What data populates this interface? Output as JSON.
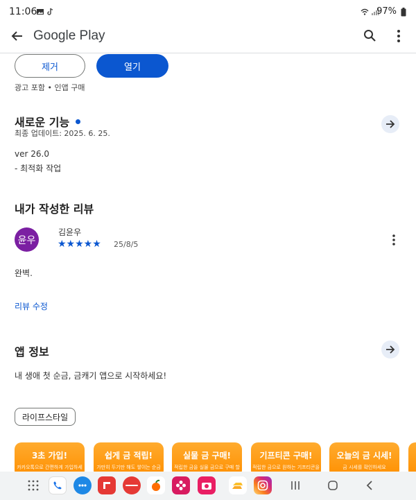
{
  "status_bar": {
    "time": "11:06",
    "battery": "97%"
  },
  "app_bar": {
    "title": "Google Play"
  },
  "actions": {
    "remove_label": "제거",
    "open_label": "열기",
    "notice": "광고 포함 • 인앱 구매"
  },
  "whats_new": {
    "title": "새로운 기능",
    "updated": "최종 업데이트: 2025. 6. 25.",
    "version": "ver 26.0",
    "note": "- 최적화 작업"
  },
  "my_review": {
    "title": "내가 작성한 리뷰",
    "avatar_text": "윤우",
    "reviewer": "김윤우",
    "stars": "★★★★★",
    "rating": 5,
    "date": "25/8/5",
    "text": "완벽.",
    "edit_label": "리뷰 수정"
  },
  "app_info": {
    "title": "앱 정보",
    "description": "내 생애 첫 순금, 금캐기 앱으로 시작하세요!",
    "category": "라이프스타일"
  },
  "screenshots": [
    {
      "title": "3초 가입!",
      "subtitle": "카카오톡으로 간편하게 가입하세요"
    },
    {
      "title": "쉽게 금 적립!",
      "subtitle": "가만히 두기만 해도 쌓이는 순금"
    },
    {
      "title": "실물 금 구매!",
      "subtitle": "적립한 금을 실물 금으로 구매 할 수 있어요"
    },
    {
      "title": "기프티콘 구매!",
      "subtitle": "적립한 금으로 원하는 기프티콘을 구매하세요"
    },
    {
      "title": "오늘의 금 시세!",
      "subtitle": "금 시세를 확인하세요"
    }
  ],
  "colors": {
    "accent": "#0b57d0",
    "avatar": "#7b1fa2",
    "promo": "#ff9800"
  }
}
